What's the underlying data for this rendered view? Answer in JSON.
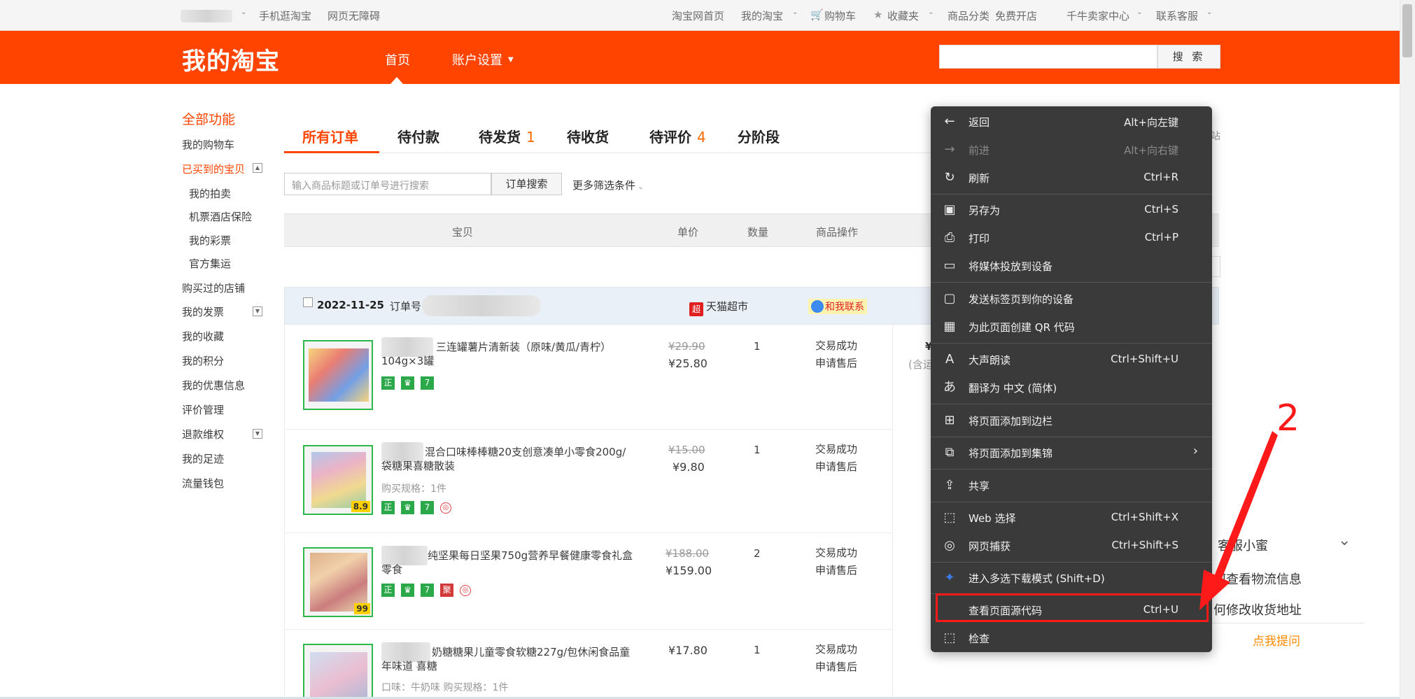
{
  "topbar": {
    "mobile_link": "手机逛淘宝",
    "accessibility": "网页无障碍",
    "home": "淘宝网首页",
    "my_taobao": "我的淘宝",
    "cart": "购物车",
    "favorites": "收藏夹",
    "categories": "商品分类",
    "open_shop": "免费开店",
    "seller_center": "千牛卖家中心",
    "service": "联系客服"
  },
  "header": {
    "logo": "我的淘宝",
    "nav_home": "首页",
    "nav_account": "账户设置",
    "search_button": "搜 索"
  },
  "sidebar": {
    "title": "全部功能",
    "items": [
      "我的购物车",
      "已买到的宝贝",
      "我的拍卖",
      "机票酒店保险",
      "我的彩票",
      "官方集运",
      "购买过的店铺",
      "我的发票",
      "我的收藏",
      "我的积分",
      "我的优惠信息",
      "评价管理",
      "退款维权",
      "我的足迹",
      "流量钱包"
    ]
  },
  "tabs": [
    {
      "label": "所有订单",
      "count": ""
    },
    {
      "label": "待付款",
      "count": ""
    },
    {
      "label": "待发货",
      "count": "1"
    },
    {
      "label": "待收货",
      "count": ""
    },
    {
      "label": "待评价",
      "count": "4"
    },
    {
      "label": "分阶段",
      "count": ""
    }
  ],
  "order_search": {
    "placeholder": "输入商品标题或订单号进行搜索",
    "button": "订单搜索",
    "more_filters": "更多筛选条件"
  },
  "table_header": {
    "item": "宝贝",
    "unit_price": "单价",
    "quantity": "数量",
    "ops": "商品操作"
  },
  "order": {
    "date": "2022-11-25",
    "order_no_label": "订单号",
    "shop": "天猫超市",
    "shop_icon": "超",
    "contact": "和我联系"
  },
  "items": [
    {
      "title": "三连罐薯片清新装（原味/黄瓜/青柠）104g×3罐",
      "spec": "",
      "orig": "¥29.90",
      "price": "¥25.80",
      "qty": "1",
      "status": "交易成功",
      "after": "申请售后"
    },
    {
      "title": "混合口味棒棒糖20支创意凑单小零食200g/袋糖果喜糖散装",
      "spec": "购买规格：1件",
      "orig": "¥15.00",
      "price": "¥9.80",
      "qty": "1",
      "status": "交易成功",
      "after": "申请售后",
      "badge": "8.9"
    },
    {
      "title": "纯坚果每日坚果750g营养早餐健康零食礼盒零食",
      "spec": "",
      "orig": "¥188.00",
      "price": "¥159.00",
      "qty": "2",
      "status": "交易成功",
      "after": "申请售后",
      "badge": "99"
    },
    {
      "title": "奶糖糖果儿童零食软糖227g/包休闲食品童年味道 喜糖",
      "spec": "口味：牛奶味   购买规格：1件",
      "orig": "",
      "price": "¥17.80",
      "qty": "1",
      "status": "交易成功",
      "after": "申请售后"
    }
  ],
  "tags": {
    "zheng": "正",
    "seven": "7",
    "ji": "聚",
    "shield": "◎"
  },
  "right_peek": {
    "partial_station": "站",
    "partial_yen": "¥",
    "partial_paren": "(含运",
    "assistant": "客服小蜜",
    "logistics": "何查看物流信息",
    "address": "何修改收货地址",
    "ask": "点我提问"
  },
  "context_menu": {
    "items": [
      {
        "label": "返回",
        "shortcut": "Alt+向左键",
        "icon": "back-arrow-icon",
        "glyph": "←"
      },
      {
        "label": "前进",
        "shortcut": "Alt+向右键",
        "icon": "forward-arrow-icon",
        "glyph": "→",
        "disabled": true
      },
      {
        "label": "刷新",
        "shortcut": "Ctrl+R",
        "icon": "refresh-icon",
        "glyph": "↻"
      },
      {
        "label": "另存为",
        "shortcut": "Ctrl+S",
        "icon": "save-icon",
        "glyph": "▣"
      },
      {
        "label": "打印",
        "shortcut": "Ctrl+P",
        "icon": "print-icon",
        "glyph": "⎙"
      },
      {
        "label": "将媒体投放到设备",
        "shortcut": "",
        "icon": "cast-icon",
        "glyph": "▭"
      },
      {
        "label": "发送标签页到你的设备",
        "shortcut": "",
        "icon": "send-device-icon",
        "glyph": "▢"
      },
      {
        "label": "为此页面创建 QR 代码",
        "shortcut": "",
        "icon": "qr-code-icon",
        "glyph": "▦"
      },
      {
        "label": "大声朗读",
        "shortcut": "Ctrl+Shift+U",
        "icon": "read-aloud-icon",
        "glyph": "A"
      },
      {
        "label": "翻译为 中文 (简体)",
        "shortcut": "",
        "icon": "translate-icon",
        "glyph": "あ"
      },
      {
        "label": "将页面添加到边栏",
        "shortcut": "",
        "icon": "add-sidebar-icon",
        "glyph": "⊞"
      },
      {
        "label": "将页面添加到集锦",
        "shortcut": "",
        "icon": "collections-icon",
        "glyph": "⧉"
      },
      {
        "label": "共享",
        "shortcut": "",
        "icon": "share-icon",
        "glyph": "⇪"
      },
      {
        "label": "Web 选择",
        "shortcut": "Ctrl+Shift+X",
        "icon": "web-select-icon",
        "glyph": "⬚"
      },
      {
        "label": "网页捕获",
        "shortcut": "Ctrl+Shift+S",
        "icon": "web-capture-icon",
        "glyph": "◎"
      },
      {
        "label": "进入多选下载模式 (Shift+D)",
        "shortcut": "",
        "icon": "download-mode-icon",
        "glyph": "✦"
      },
      {
        "label": "查看页面源代码",
        "shortcut": "Ctrl+U",
        "icon": "view-source-icon",
        "glyph": ""
      },
      {
        "label": "检查",
        "shortcut": "",
        "icon": "inspect-icon",
        "glyph": "⬚"
      }
    ],
    "submenu_arrow": "›"
  },
  "annotation": {
    "number": "2"
  },
  "colors": {
    "brand": "#ff4400",
    "menu_bg": "#3a3a3a",
    "highlight": "#ff1a1a"
  }
}
